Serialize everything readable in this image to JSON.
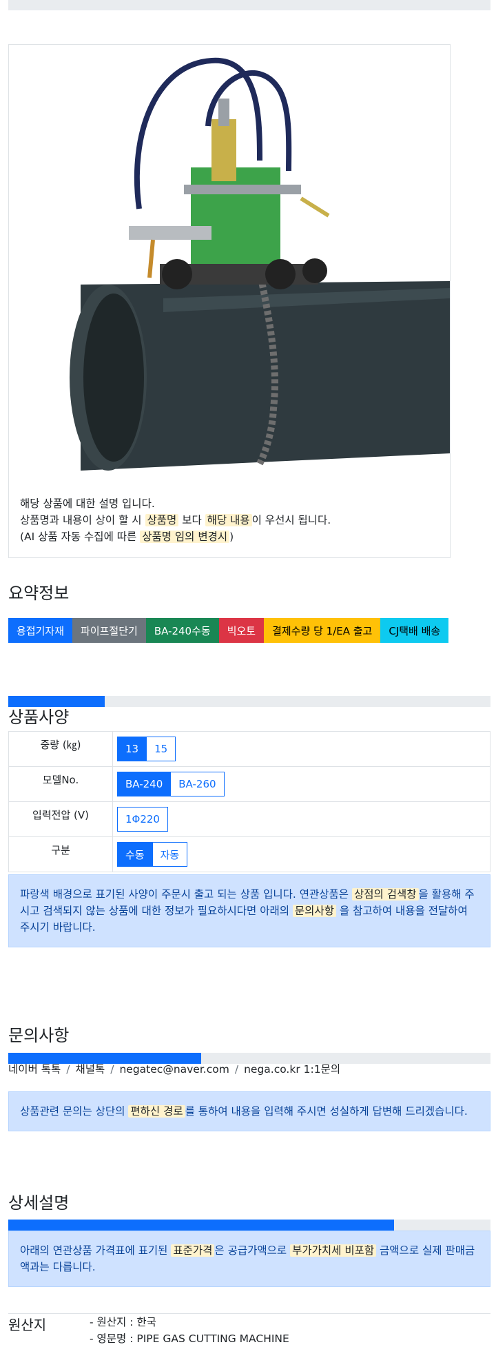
{
  "description": {
    "line1": "해당 상품에 대한 설명 입니다.",
    "line2_pre": "상품명과 내용이 상이 할 시 ",
    "line2_hl1": "상품명",
    "line2_mid": " 보다 ",
    "line2_hl2": "해당 내용",
    "line2_post": "이 우선시 됩니다.",
    "line3_pre": "(AI 상품 자동 수집에 따른 ",
    "line3_hl": "상품명 임의 변경시",
    "line3_post": ")"
  },
  "summary": {
    "title": "요약정보",
    "badges": [
      {
        "label": "용접기자재",
        "color": "#0d6efd"
      },
      {
        "label": "파이프절단기",
        "color": "#6c757d"
      },
      {
        "label": "BA-240수동",
        "color": "#198754"
      },
      {
        "label": "빅오토",
        "color": "#dc3545"
      },
      {
        "label": "결제수량 당 1/EA 출고",
        "color": "#ffc107",
        "text_color": "#000000"
      },
      {
        "label": "CJ택배 배송",
        "color": "#0dcaf0",
        "text_color": "#000000"
      }
    ]
  },
  "spec": {
    "title": "상품사양",
    "progress_fraction": 0.2,
    "rows": [
      {
        "label": "중량 (㎏)",
        "options": [
          "13",
          "15"
        ],
        "active": 0
      },
      {
        "label": "모델No.",
        "options": [
          "BA-240",
          "BA-260"
        ],
        "active": 0
      },
      {
        "label": "입력전압 (V)",
        "options": [
          "1Φ220"
        ],
        "active": -1
      },
      {
        "label": "구분",
        "options": [
          "수동",
          "자동"
        ],
        "active": 0
      }
    ],
    "notice_pre": "파랑색 배경으로 표기된 사양이 주문시 출고 되는 상품 입니다. 연관상품은 ",
    "notice_hl1": "상점의 검색창",
    "notice_mid": "을 활용해 주시고 검색되지 않는 상품에 대한 정보가 필요하시다면 아래의 ",
    "notice_hl2": "문의사항",
    "notice_post": " 을 참고하여 내용을 전달하여 주시기 바랍니다."
  },
  "inquiry": {
    "title": "문의사항",
    "progress_fraction": 0.4,
    "links": [
      "네이버 톡톡",
      "채널톡",
      "negatec@naver.com",
      "nega.co.kr 1:1문의"
    ],
    "separator": "/",
    "notice_pre": "상품관련 문의는 상단의 ",
    "notice_hl": "편하신 경로",
    "notice_post": "를 통하여 내용을 입력해 주시면 성실하게 답변해 드리겠습니다."
  },
  "detail": {
    "title": "상세설명",
    "progress_fraction": 0.8,
    "notice_pre": "아래의 연관상품 가격표에 표기된 ",
    "notice_hl1": "표준가격",
    "notice_mid": "은 공급가액으로 ",
    "notice_hl2": "부가가치세 비포함",
    "notice_post": " 금액으로 실제 판매금액과는 다릅니다."
  },
  "origin": {
    "title": "원산지",
    "items": [
      "- 원산지 : 한국",
      "- 영문명 : PIPE GAS CUTTING MACHINE"
    ]
  }
}
